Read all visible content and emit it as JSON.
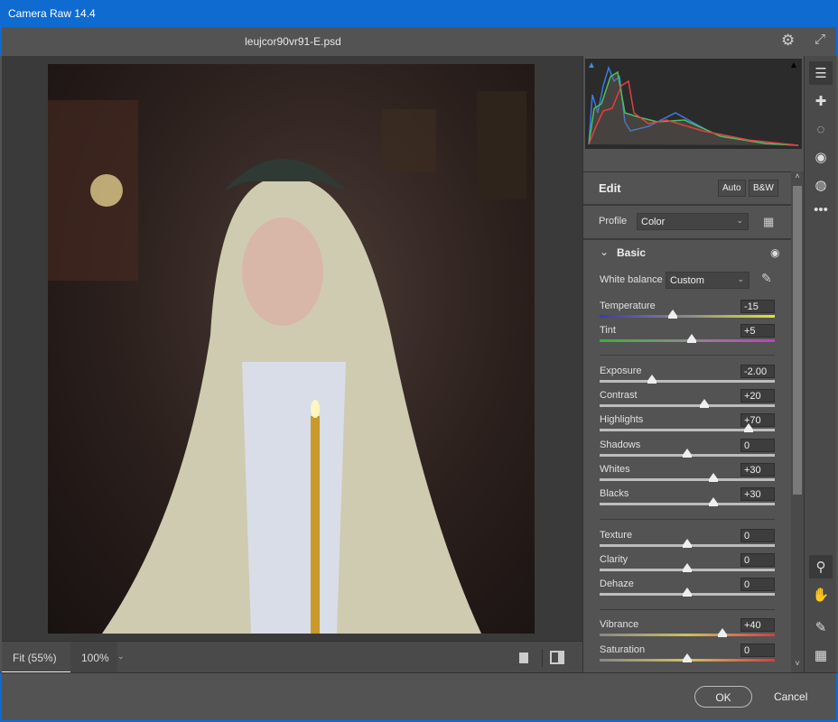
{
  "window": {
    "title": "Camera Raw 14.4",
    "filename": "leujcor90vr91-E.psd"
  },
  "bottombar": {
    "fit": "Fit (55%)",
    "zoom": "100%"
  },
  "edit": {
    "title": "Edit",
    "auto": "Auto",
    "bw": "B&W"
  },
  "profile": {
    "label": "Profile",
    "value": "Color"
  },
  "basic": {
    "title": "Basic",
    "wb_label": "White balance",
    "wb_value": "Custom",
    "sliders": [
      {
        "label": "Temperature",
        "value": "-15",
        "pos": 0.42
      },
      {
        "label": "Tint",
        "value": "+5",
        "pos": 0.525
      },
      {
        "label": "Exposure",
        "value": "-2.00",
        "pos": 0.3
      },
      {
        "label": "Contrast",
        "value": "+20",
        "pos": 0.6
      },
      {
        "label": "Highlights",
        "value": "+70",
        "pos": 0.85
      },
      {
        "label": "Shadows",
        "value": "0",
        "pos": 0.5
      },
      {
        "label": "Whites",
        "value": "+30",
        "pos": 0.65
      },
      {
        "label": "Blacks",
        "value": "+30",
        "pos": 0.65
      },
      {
        "label": "Texture",
        "value": "0",
        "pos": 0.5
      },
      {
        "label": "Clarity",
        "value": "0",
        "pos": 0.5
      },
      {
        "label": "Dehaze",
        "value": "0",
        "pos": 0.5
      },
      {
        "label": "Vibrance",
        "value": "+40",
        "pos": 0.7
      },
      {
        "label": "Saturation",
        "value": "0",
        "pos": 0.5
      }
    ]
  },
  "footer": {
    "ok": "OK",
    "cancel": "Cancel"
  },
  "colors": {
    "titlebar": "#0f6bd0",
    "panel": "#535353"
  }
}
